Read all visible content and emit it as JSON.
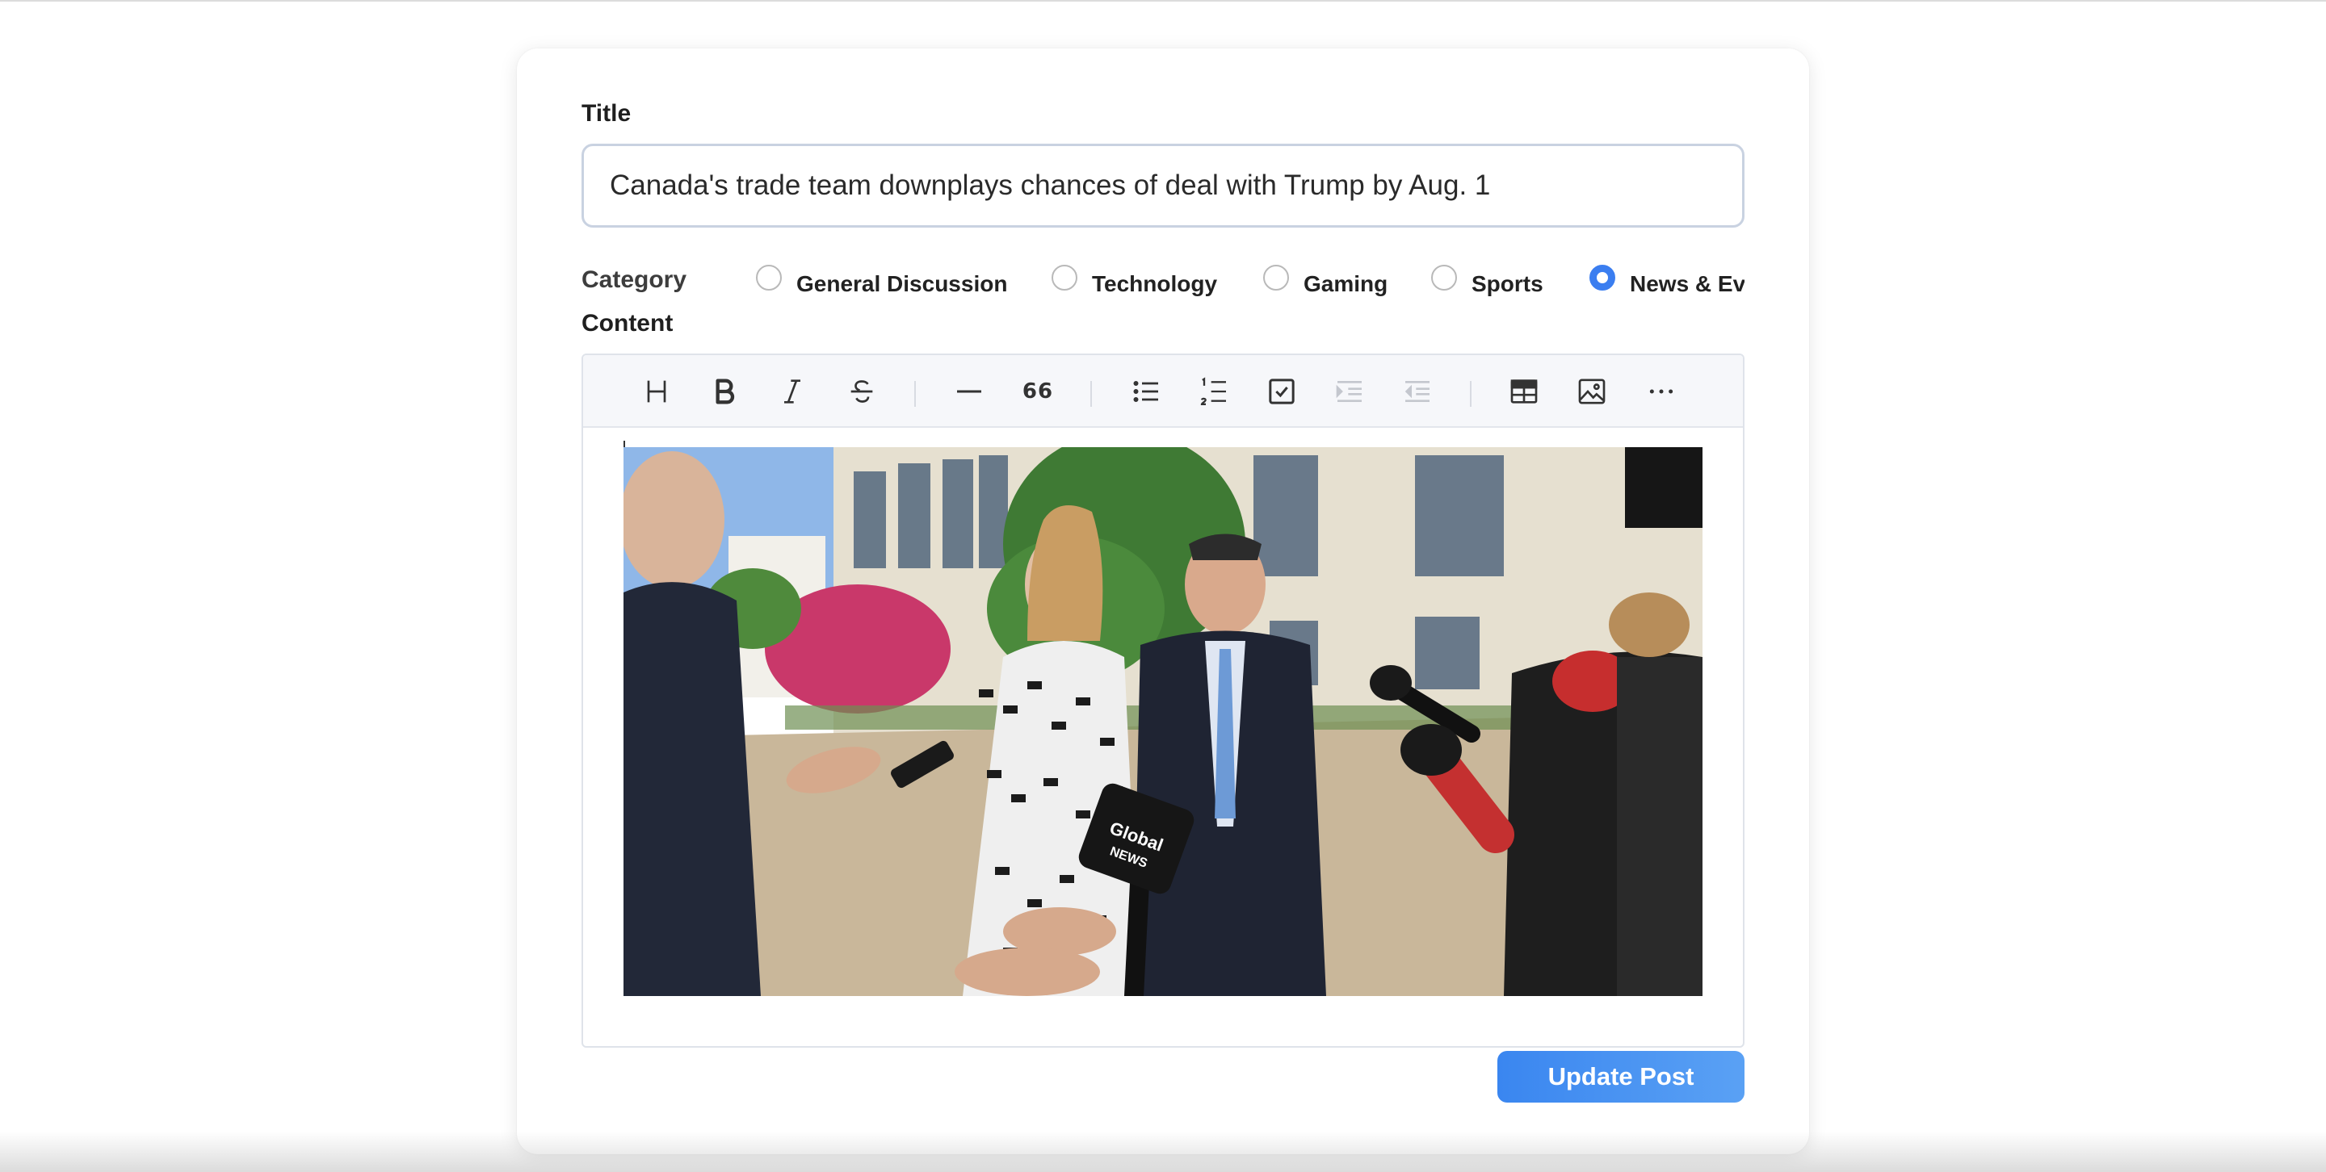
{
  "form": {
    "title_label": "Title",
    "title_value": "Canada's trade team downplays chances of deal with Trump by Aug. 1",
    "category_label": "Category",
    "categories": [
      {
        "label": "General Discussion",
        "checked": false
      },
      {
        "label": "Technology",
        "checked": false
      },
      {
        "label": "Gaming",
        "checked": false
      },
      {
        "label": "Sports",
        "checked": false
      },
      {
        "label": "News & Ev",
        "checked": true
      }
    ],
    "content_label": "Content",
    "submit_label": "Update Post"
  },
  "toolbar": {
    "buttons": [
      "heading-icon",
      "bold-icon",
      "italic-icon",
      "strikethrough-icon",
      "horizontal-rule-icon",
      "blockquote-icon",
      "bullet-list-icon",
      "ordered-list-icon",
      "task-list-icon",
      "indent-icon",
      "outdent-icon",
      "table-icon",
      "image-icon",
      "more-icon"
    ],
    "blockquote_glyph": "66"
  },
  "photo": {
    "logo_text_1": "Global",
    "logo_text_2": "NEWS"
  },
  "colors": {
    "accent": "#3b7ef0",
    "button_gradient_start": "#3a86f0",
    "button_gradient_end": "#5aa1f4"
  }
}
